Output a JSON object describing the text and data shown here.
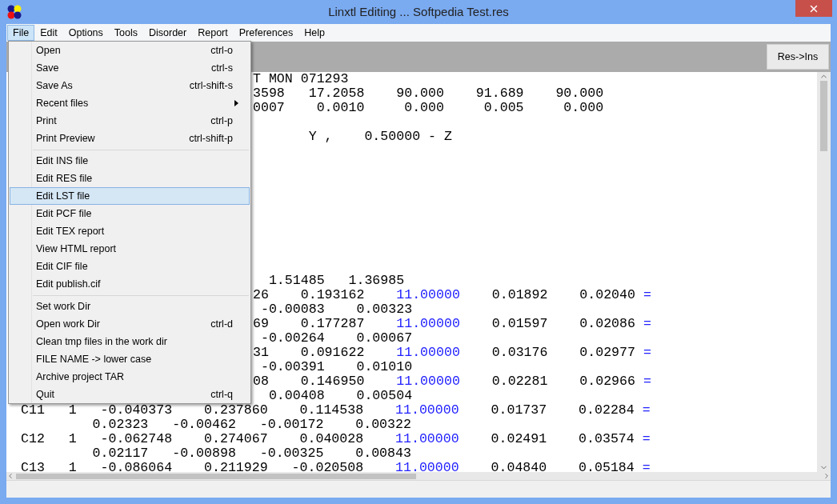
{
  "window": {
    "title": "Linxtl Editing ... Softpedia Test.res"
  },
  "menubar": [
    {
      "label": "File",
      "selected": true
    },
    {
      "label": "Edit",
      "selected": false
    },
    {
      "label": "Options",
      "selected": false
    },
    {
      "label": "Tools",
      "selected": false
    },
    {
      "label": "Disorder",
      "selected": false
    },
    {
      "label": "Report",
      "selected": false
    },
    {
      "label": "Preferences",
      "selected": false
    },
    {
      "label": "Help",
      "selected": false
    }
  ],
  "file_menu": [
    [
      {
        "label": "Open",
        "shortcut": "ctrl-o",
        "submenu": false,
        "selected": false
      },
      {
        "label": "Save",
        "shortcut": "ctrl-s",
        "submenu": false,
        "selected": false
      },
      {
        "label": "Save As",
        "shortcut": "ctrl-shift-s",
        "submenu": false,
        "selected": false
      },
      {
        "label": "Recent files",
        "submenu": true,
        "selected": false
      },
      {
        "label": "Print",
        "shortcut": "ctrl-p",
        "submenu": false,
        "selected": false
      },
      {
        "label": "Print Preview",
        "shortcut": "ctrl-shift-p",
        "submenu": false,
        "selected": false
      }
    ],
    [
      {
        "label": "Edit INS file",
        "submenu": false,
        "selected": false
      },
      {
        "label": "Edit RES file",
        "submenu": false,
        "selected": false
      },
      {
        "label": "Edit LST file",
        "submenu": false,
        "selected": true
      },
      {
        "label": "Edit PCF file",
        "submenu": false,
        "selected": false
      },
      {
        "label": "Edit TEX report",
        "submenu": false,
        "selected": false
      },
      {
        "label": "View HTML report",
        "submenu": false,
        "selected": false
      },
      {
        "label": "Edit CIF file",
        "submenu": false,
        "selected": false
      },
      {
        "label": "Edit publish.cif",
        "submenu": false,
        "selected": false
      }
    ],
    [
      {
        "label": "Set work Dir",
        "submenu": false,
        "selected": false
      },
      {
        "label": "Open work Dir",
        "shortcut": "ctrl-d",
        "submenu": false,
        "selected": false
      },
      {
        "label": "Clean tmp files in the work dir",
        "submenu": false,
        "selected": false
      },
      {
        "label": "FILE NAME -> lower case",
        "submenu": false,
        "selected": false
      },
      {
        "label": "Archive project TAR",
        "submenu": false,
        "selected": false
      },
      {
        "label": "Quit",
        "shortcut": "ctrl-q",
        "submenu": false,
        "selected": false
      }
    ]
  ],
  "toolbar": {
    "button": "Res->Ins"
  },
  "editor": {
    "lines": [
      {
        "kind": "covered",
        "segments": [
          {
            "kind": "plain",
            "text": "T MON 071293"
          }
        ]
      },
      {
        "kind": "covered",
        "segments": [
          {
            "kind": "plain",
            "text": "3598   17.2058    90.000    91.689    90.000"
          }
        ]
      },
      {
        "kind": "covered",
        "segments": [
          {
            "kind": "plain",
            "text": "0007    0.0010     0.000     0.005     0.000"
          }
        ]
      },
      {
        "kind": "blank"
      },
      {
        "kind": "covered",
        "segments": [
          {
            "kind": "plain",
            "text": "       Y ,    0.50000 - Z"
          }
        ]
      },
      {
        "kind": "blank"
      },
      {
        "kind": "blank"
      },
      {
        "kind": "blank"
      },
      {
        "kind": "blank"
      },
      {
        "kind": "blank"
      },
      {
        "kind": "blank"
      },
      {
        "kind": "blank"
      },
      {
        "kind": "blank"
      },
      {
        "kind": "blank"
      },
      {
        "kind": "covered",
        "segments": [
          {
            "kind": "plain",
            "text": "  1.51485   1.36985"
          }
        ]
      },
      {
        "kind": "covered",
        "segments": [
          {
            "kind": "plain",
            "text": "26    0.193162    "
          },
          {
            "kind": "fixed",
            "text": "11.00000"
          },
          {
            "kind": "plain",
            "text": "    0.01892    0.02040 "
          },
          {
            "kind": "fixed",
            "text": "="
          }
        ]
      },
      {
        "kind": "covered",
        "segments": [
          {
            "kind": "plain",
            "text": " -0.00083    0.00323"
          }
        ]
      },
      {
        "kind": "covered",
        "segments": [
          {
            "kind": "plain",
            "text": "69    0.177287    "
          },
          {
            "kind": "fixed",
            "text": "11.00000"
          },
          {
            "kind": "plain",
            "text": "    0.01597    0.02086 "
          },
          {
            "kind": "fixed",
            "text": "="
          }
        ]
      },
      {
        "kind": "covered",
        "segments": [
          {
            "kind": "plain",
            "text": " -0.00264    0.00067"
          }
        ]
      },
      {
        "kind": "covered",
        "segments": [
          {
            "kind": "plain",
            "text": "31    0.091622    "
          },
          {
            "kind": "fixed",
            "text": "11.00000"
          },
          {
            "kind": "plain",
            "text": "    0.03176    0.02977 "
          },
          {
            "kind": "fixed",
            "text": "="
          }
        ]
      },
      {
        "kind": "covered",
        "segments": [
          {
            "kind": "plain",
            "text": " -0.00391    0.01010"
          }
        ]
      },
      {
        "kind": "covered",
        "segments": [
          {
            "kind": "plain",
            "text": "08    0.146950    "
          },
          {
            "kind": "fixed",
            "text": "11.00000"
          },
          {
            "kind": "plain",
            "text": "    0.02281    0.02966 "
          },
          {
            "kind": "fixed",
            "text": "="
          }
        ]
      },
      {
        "kind": "covered",
        "segments": [
          {
            "kind": "plain",
            "text": "  0.00408    0.00504"
          }
        ]
      },
      {
        "kind": "full",
        "segments": [
          {
            "kind": "plain",
            "text": "C11   1   -0.040373    0.237860    0.114538    "
          },
          {
            "kind": "fixed",
            "text": "11.00000"
          },
          {
            "kind": "plain",
            "text": "    0.01737    0.02284 "
          },
          {
            "kind": "fixed",
            "text": "="
          }
        ]
      },
      {
        "kind": "full",
        "segments": [
          {
            "kind": "plain",
            "text": "         0.02323   -0.00462   -0.00172    0.00322"
          }
        ]
      },
      {
        "kind": "full",
        "segments": [
          {
            "kind": "plain",
            "text": "C12   1   -0.062748    0.274067    0.040028    "
          },
          {
            "kind": "fixed",
            "text": "11.00000"
          },
          {
            "kind": "plain",
            "text": "    0.02491    0.03574 "
          },
          {
            "kind": "fixed",
            "text": "="
          }
        ]
      },
      {
        "kind": "full",
        "segments": [
          {
            "kind": "plain",
            "text": "         0.02117   -0.00898   -0.00325    0.00843"
          }
        ]
      },
      {
        "kind": "full",
        "segments": [
          {
            "kind": "plain",
            "text": "C13   1   -0.086064    0.211929   -0.020508    "
          },
          {
            "kind": "fixed",
            "text": "11.00000"
          },
          {
            "kind": "plain",
            "text": "    0.04840    0.05184 "
          },
          {
            "kind": "fixed",
            "text": "="
          }
        ]
      }
    ]
  }
}
